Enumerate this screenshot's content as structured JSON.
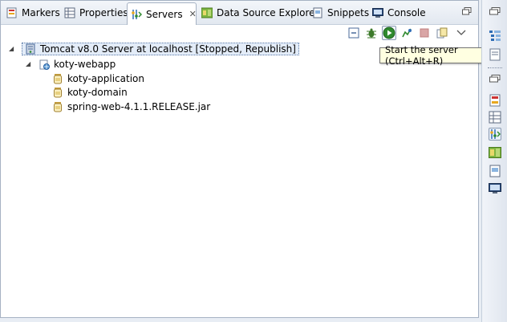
{
  "tabs": [
    {
      "label": "Markers",
      "icon": "markers-icon"
    },
    {
      "label": "Properties",
      "icon": "properties-icon"
    },
    {
      "label": "Servers",
      "icon": "servers-icon",
      "active": true
    },
    {
      "label": "Data Source Explorer",
      "icon": "data-source-icon"
    },
    {
      "label": "Snippets",
      "icon": "snippets-icon"
    },
    {
      "label": "Console",
      "icon": "console-icon"
    }
  ],
  "tree": {
    "server": {
      "label": "Tomcat v8.0 Server at localhost  [Stopped, Republish]"
    },
    "module": {
      "label": "koty-webapp"
    },
    "children": [
      {
        "label": "koty-application"
      },
      {
        "label": "koty-domain"
      },
      {
        "label": "spring-web-4.1.1.RELEASE.jar"
      }
    ]
  },
  "tooltip": {
    "text": "Start the server (Ctrl+Alt+R)"
  },
  "colors": {
    "accent": "#2f8a2f",
    "selection": "#e3ecf8",
    "panel_border": "#a6b2c3"
  }
}
